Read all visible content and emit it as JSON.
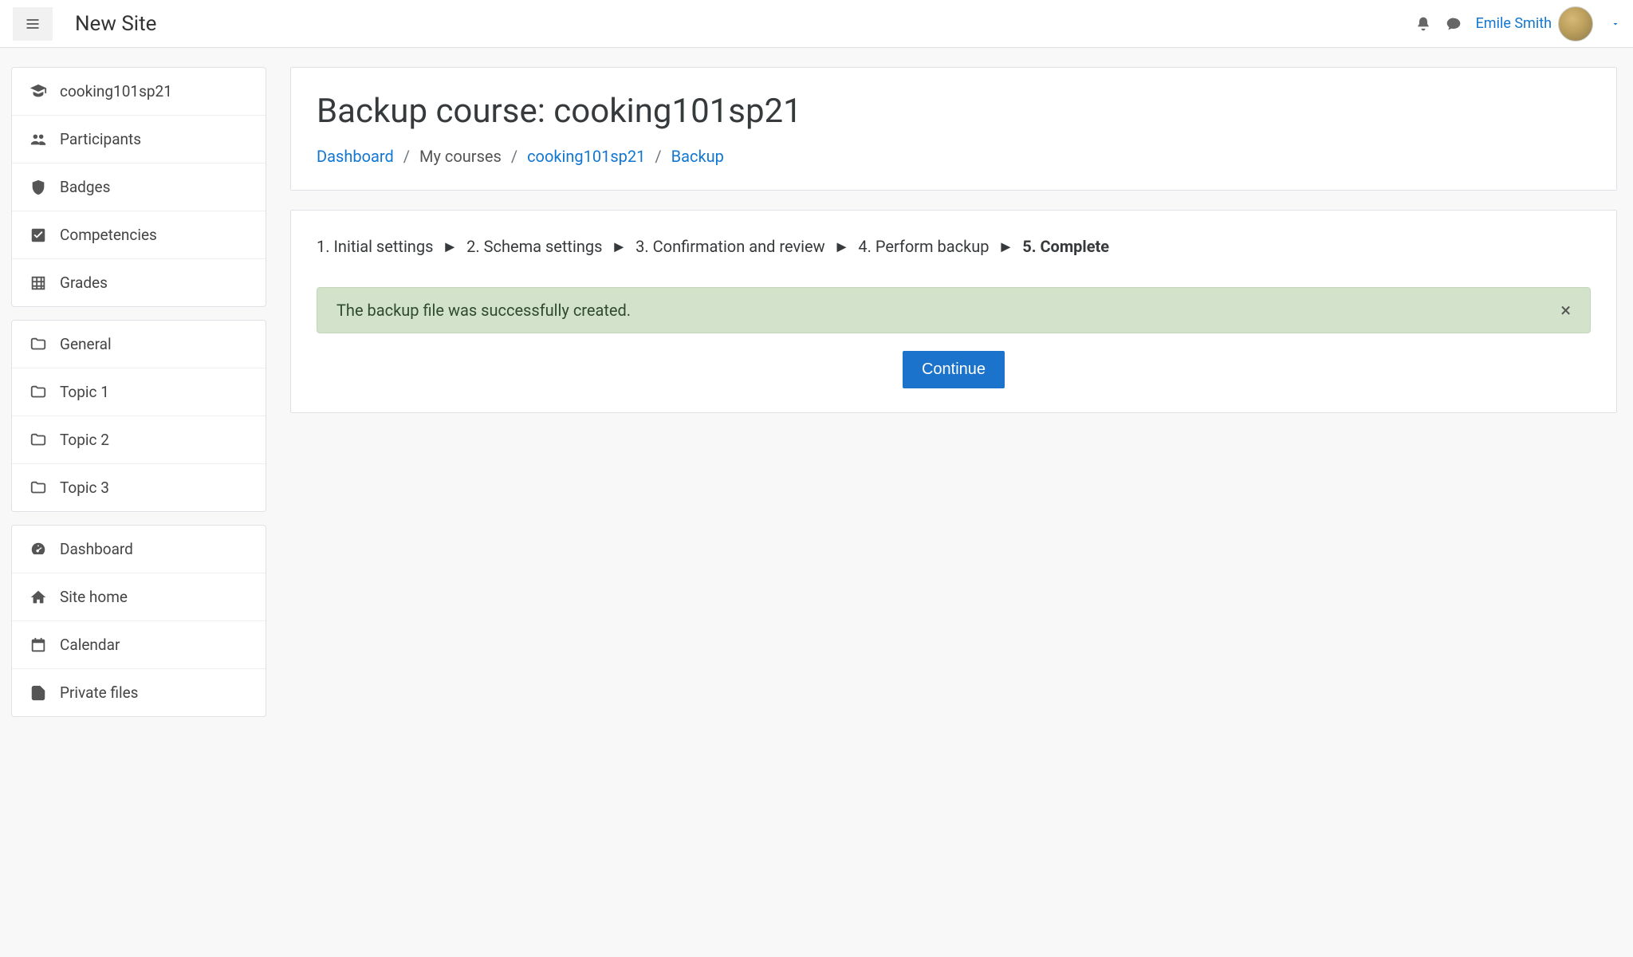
{
  "header": {
    "site_brand": "New Site",
    "user_name": "Emile Smith"
  },
  "sidebar": {
    "groups": [
      {
        "items": [
          {
            "icon": "graduation",
            "label": "cooking101sp21",
            "name": "course-link"
          },
          {
            "icon": "users",
            "label": "Participants",
            "name": "participants-link"
          },
          {
            "icon": "badge",
            "label": "Badges",
            "name": "badges-link"
          },
          {
            "icon": "check",
            "label": "Competencies",
            "name": "competencies-link"
          },
          {
            "icon": "grid",
            "label": "Grades",
            "name": "grades-link"
          }
        ]
      },
      {
        "items": [
          {
            "icon": "folder",
            "label": "General",
            "name": "section-general"
          },
          {
            "icon": "folder",
            "label": "Topic 1",
            "name": "section-topic-1"
          },
          {
            "icon": "folder",
            "label": "Topic 2",
            "name": "section-topic-2"
          },
          {
            "icon": "folder",
            "label": "Topic 3",
            "name": "section-topic-3"
          }
        ]
      },
      {
        "items": [
          {
            "icon": "tachometer",
            "label": "Dashboard",
            "name": "dashboard-link"
          },
          {
            "icon": "home",
            "label": "Site home",
            "name": "sitehome-link"
          },
          {
            "icon": "calendar",
            "label": "Calendar",
            "name": "calendar-link"
          },
          {
            "icon": "file",
            "label": "Private files",
            "name": "privatefiles-link"
          }
        ]
      }
    ]
  },
  "main": {
    "title": "Backup course: cooking101sp21",
    "breadcrumb": {
      "dashboard": "Dashboard",
      "mycourses": "My courses",
      "course": "cooking101sp21",
      "page": "Backup",
      "sep": "/"
    },
    "steps": {
      "s1": "1. Initial settings",
      "s2": "2. Schema settings",
      "s3": "3. Confirmation and review",
      "s4": "4. Perform backup",
      "s5": "5. Complete",
      "arrow": "►"
    },
    "alert_text": "The backup file was successfully created.",
    "alert_close": "×",
    "continue_label": "Continue"
  }
}
